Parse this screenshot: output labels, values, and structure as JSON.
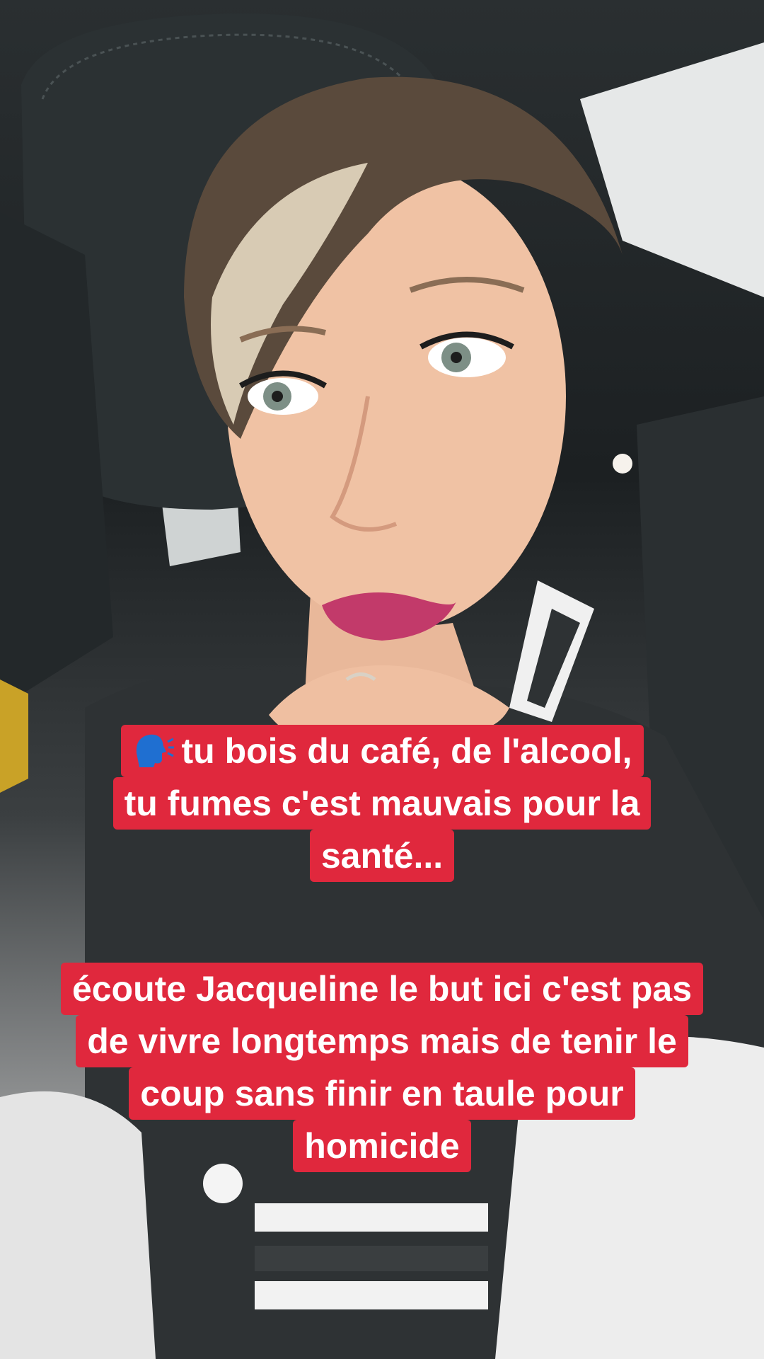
{
  "scene": {
    "icon": "speaking-head-icon"
  },
  "captions": {
    "first": {
      "lines": [
        "tu bois du café, de l'alcool,",
        "tu fumes c'est mauvais pour la",
        "santé..."
      ]
    },
    "second": {
      "lines": [
        "écoute Jacqueline le but ici c'est pas",
        "de vivre longtemps mais de tenir le",
        "coup sans finir en taule pour",
        "homicide"
      ]
    }
  },
  "colors": {
    "caption_bg": "#e0283d",
    "caption_text": "#ffffff"
  }
}
